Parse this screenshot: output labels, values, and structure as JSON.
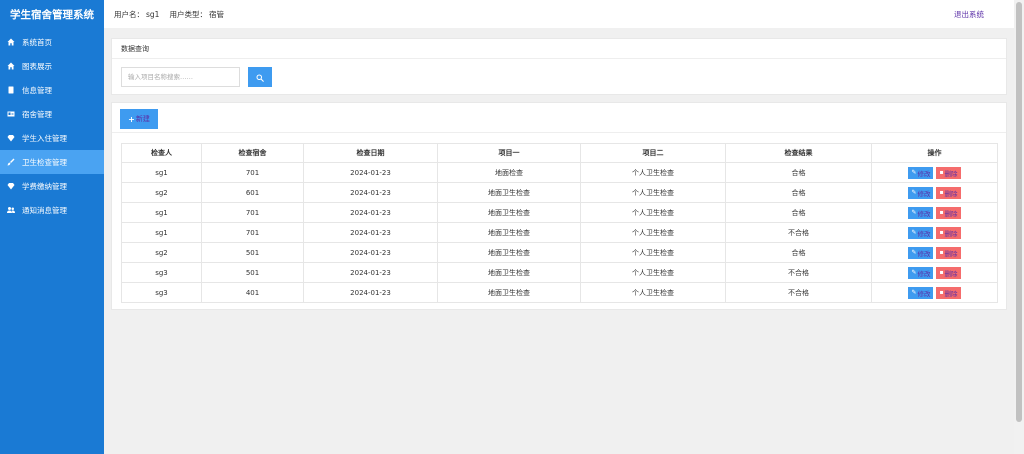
{
  "app": {
    "title": "学生宿舍管理系统"
  },
  "header": {
    "username_label": "用户名：",
    "username": "sg1",
    "usertype_label": "用户类型：",
    "usertype": "宿管",
    "logout": "退出系统"
  },
  "sidebar": {
    "items": [
      {
        "label": "系统首页",
        "icon": "home-icon"
      },
      {
        "label": "图表展示",
        "icon": "home-icon"
      },
      {
        "label": "信息管理",
        "icon": "book-icon"
      },
      {
        "label": "宿舍管理",
        "icon": "id-card-icon"
      },
      {
        "label": "学生入住管理",
        "icon": "diamond-icon"
      },
      {
        "label": "卫生检查管理",
        "icon": "brush-icon",
        "active": true
      },
      {
        "label": "学费缴纳管理",
        "icon": "diamond-icon"
      },
      {
        "label": "通知消息管理",
        "icon": "users-icon"
      }
    ]
  },
  "query": {
    "title": "数据查询",
    "placeholder": "输入项目名称搜索……"
  },
  "toolbar": {
    "new_label": "新建"
  },
  "table": {
    "headers": [
      "检查人",
      "检查宿舍",
      "检查日期",
      "项目一",
      "项目二",
      "检查结果",
      "操作"
    ],
    "rows": [
      [
        "sg1",
        "701",
        "2024-01-23",
        "地面检查",
        "个人卫生检查",
        "合格"
      ],
      [
        "sg2",
        "601",
        "2024-01-23",
        "地面卫生检查",
        "个人卫生检查",
        "合格"
      ],
      [
        "sg1",
        "701",
        "2024-01-23",
        "地面卫生检查",
        "个人卫生检查",
        "合格"
      ],
      [
        "sg1",
        "701",
        "2024-01-23",
        "地面卫生检查",
        "个人卫生检查",
        "不合格"
      ],
      [
        "sg2",
        "501",
        "2024-01-23",
        "地面卫生检查",
        "个人卫生检查",
        "合格"
      ],
      [
        "sg3",
        "501",
        "2024-01-23",
        "地面卫生检查",
        "个人卫生检查",
        "不合格"
      ],
      [
        "sg3",
        "401",
        "2024-01-23",
        "地面卫生检查",
        "个人卫生检查",
        "不合格"
      ]
    ],
    "edit_label": "修改",
    "delete_label": "删除"
  },
  "colors": {
    "sidebar": "#1a7ad4",
    "active_item": "#4aa3f2",
    "primary_button": "#3e9bf0",
    "danger_button": "#f56c6c",
    "link": "#5b2fa7"
  }
}
